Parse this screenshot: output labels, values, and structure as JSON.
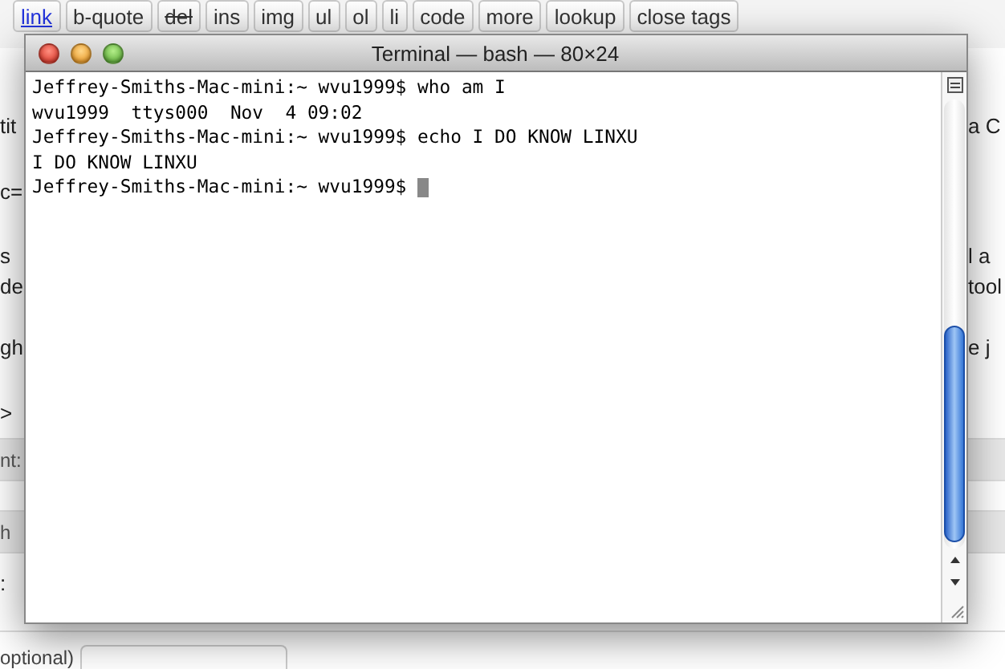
{
  "editor_toolbar": [
    {
      "label": "link",
      "kind": "link"
    },
    {
      "label": "b-quote",
      "kind": "button"
    },
    {
      "label": "del",
      "kind": "strike"
    },
    {
      "label": "ins",
      "kind": "button"
    },
    {
      "label": "img",
      "kind": "button"
    },
    {
      "label": "ul",
      "kind": "button"
    },
    {
      "label": "ol",
      "kind": "button"
    },
    {
      "label": "li",
      "kind": "button"
    },
    {
      "label": "code",
      "kind": "button"
    },
    {
      "label": "more",
      "kind": "button"
    },
    {
      "label": "lookup",
      "kind": "button"
    },
    {
      "label": "close tags",
      "kind": "button"
    }
  ],
  "background_rows": [
    {
      "kind": "text",
      "left": "tit",
      "right": "a C"
    },
    {
      "kind": "text",
      "left": "c="
    },
    {
      "kind": "text",
      "left": "s",
      "right": "l a"
    },
    {
      "kind": "text",
      "left": "de",
      "right": "tool"
    },
    {
      "kind": "text",
      "left": "gh",
      "right": "e j"
    },
    {
      "kind": "text",
      "left": ">"
    },
    {
      "kind": "band",
      "left": "nt:"
    },
    {
      "kind": "band",
      "left": "h"
    },
    {
      "kind": "text",
      "left": ":"
    }
  ],
  "optional_label": "optional)",
  "terminal": {
    "title": "Terminal — bash — 80×24",
    "lines": [
      "Jeffrey-Smiths-Mac-mini:~ wvu1999$ who am I",
      "wvu1999  ttys000  Nov  4 09:02",
      "Jeffrey-Smiths-Mac-mini:~ wvu1999$ echo I DO KNOW LINXU",
      "I DO KNOW LINXU",
      "Jeffrey-Smiths-Mac-mini:~ wvu1999$ "
    ],
    "cursor": true
  }
}
